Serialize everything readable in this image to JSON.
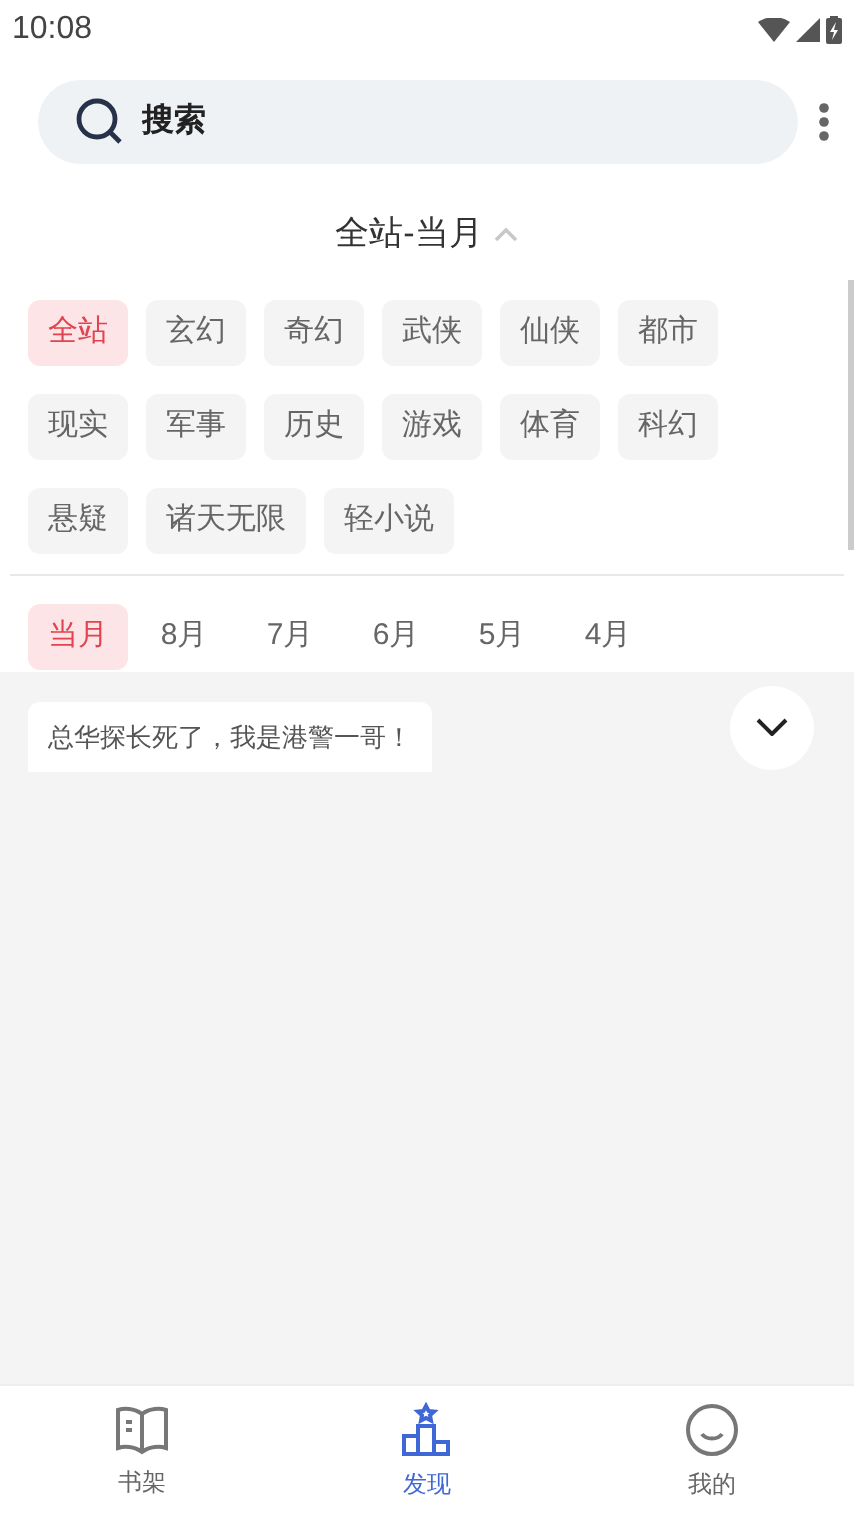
{
  "status_bar": {
    "time": "10:08"
  },
  "search": {
    "placeholder": "搜索"
  },
  "filter_header": {
    "label": "全站-当月",
    "expanded": true
  },
  "categories": [
    {
      "label": "全站",
      "selected": true
    },
    {
      "label": "玄幻",
      "selected": false
    },
    {
      "label": "奇幻",
      "selected": false
    },
    {
      "label": "武侠",
      "selected": false
    },
    {
      "label": "仙侠",
      "selected": false
    },
    {
      "label": "都市",
      "selected": false
    },
    {
      "label": "现实",
      "selected": false
    },
    {
      "label": "军事",
      "selected": false
    },
    {
      "label": "历史",
      "selected": false
    },
    {
      "label": "游戏",
      "selected": false
    },
    {
      "label": "体育",
      "selected": false
    },
    {
      "label": "科幻",
      "selected": false
    },
    {
      "label": "悬疑",
      "selected": false
    },
    {
      "label": "诸天无限",
      "selected": false
    },
    {
      "label": "轻小说",
      "selected": false
    }
  ],
  "months": [
    {
      "label": "当月",
      "selected": true
    },
    {
      "label": "8月",
      "selected": false
    },
    {
      "label": "7月",
      "selected": false
    },
    {
      "label": "6月",
      "selected": false
    },
    {
      "label": "5月",
      "selected": false
    },
    {
      "label": "4月",
      "selected": false
    }
  ],
  "books": [
    {
      "title": "总华探长死了，我是港警一哥！"
    }
  ],
  "bottom_nav": [
    {
      "label": "书架",
      "kind": "book",
      "selected": false
    },
    {
      "label": "发现",
      "kind": "podium",
      "selected": true
    },
    {
      "label": "我的",
      "kind": "smile",
      "selected": false
    }
  ]
}
